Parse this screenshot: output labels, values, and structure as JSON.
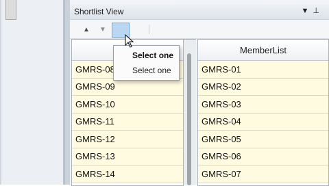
{
  "panel": {
    "title": "Shortlist View",
    "title_icons": {
      "menu": "dropdown-triangle",
      "pin": "pin-icon"
    }
  },
  "toolbar": {
    "up_icon": "up-arrow-icon",
    "down_icon": "down-arrow-icon"
  },
  "popup": {
    "title": "Select one",
    "item": "Select one"
  },
  "left_grid": {
    "header": "",
    "rows": [
      "GMRS-08",
      "GMRS-09",
      "GMRS-10",
      "GMRS-11",
      "GMRS-12",
      "GMRS-13",
      "GMRS-14"
    ]
  },
  "right_grid": {
    "header": "MemberList",
    "rows": [
      "GMRS-01",
      "GMRS-02",
      "GMRS-03",
      "GMRS-04",
      "GMRS-05",
      "GMRS-06",
      "GMRS-07"
    ]
  },
  "colors": {
    "row_bg": "#fffbe0",
    "selection": "#b9d7f2"
  }
}
